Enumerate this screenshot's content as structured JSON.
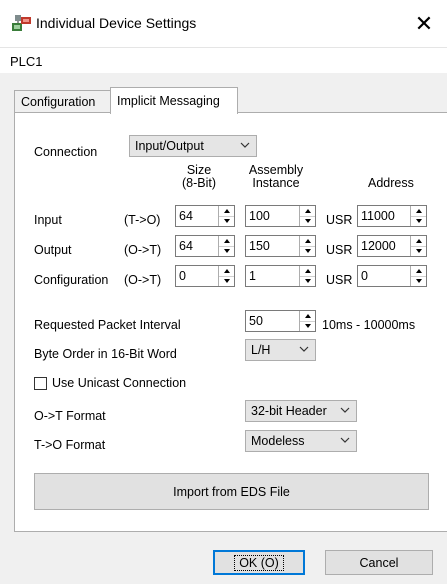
{
  "window": {
    "title": "Individual Device Settings",
    "close_glyph": "✕"
  },
  "device": {
    "name": "PLC1"
  },
  "tabs": [
    {
      "label": "Configuration",
      "active": false
    },
    {
      "label": "Implicit Messaging",
      "active": true
    }
  ],
  "connection": {
    "label": "Connection",
    "value": "Input/Output"
  },
  "headers": {
    "size_line1": "Size",
    "size_line2": "(8-Bit)",
    "assembly_line1": "Assembly",
    "assembly_line2": "Instance",
    "address": "Address"
  },
  "rows": [
    {
      "label": "Input",
      "dir": "(T->O)",
      "size": "64",
      "instance": "100",
      "prefix": "USR",
      "address": "11000"
    },
    {
      "label": "Output",
      "dir": "(O->T)",
      "size": "64",
      "instance": "150",
      "prefix": "USR",
      "address": "12000"
    },
    {
      "label": "Configuration",
      "dir": "(O->T)",
      "size": "0",
      "instance": "1",
      "prefix": "USR",
      "address": "0"
    }
  ],
  "rpi": {
    "label": "Requested Packet Interval",
    "value": "50",
    "range": "10ms - 10000ms"
  },
  "byte_order": {
    "label": "Byte Order in 16-Bit Word",
    "value": "L/H"
  },
  "unicast": {
    "label": "Use Unicast Connection",
    "checked": false
  },
  "ot_format": {
    "label": "O->T Format",
    "value": "32-bit Header"
  },
  "to_format": {
    "label": "T->O Format",
    "value": "Modeless"
  },
  "import_button": {
    "label": "Import from EDS File"
  },
  "buttons": {
    "ok": "OK (O)",
    "cancel": "Cancel"
  },
  "colors": {
    "accent": "#0078d7",
    "panel_bg": "#ffffff",
    "window_bg": "#f0f0f0"
  }
}
